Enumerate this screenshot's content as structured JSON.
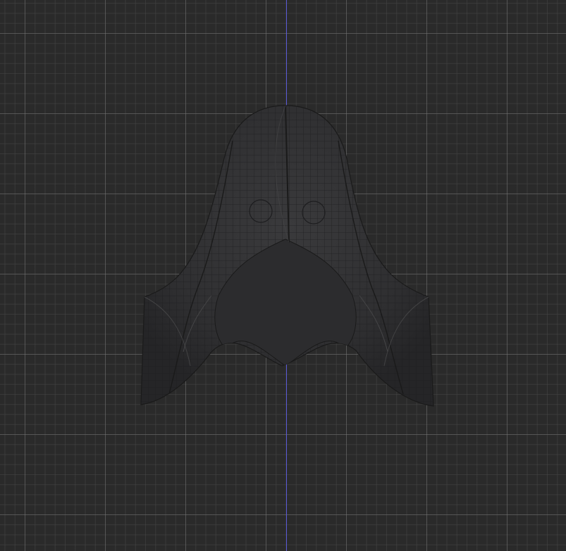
{
  "viewport": {
    "background_color": "#2a2a2a",
    "grid_major_color": "#7a7a7a",
    "grid_minor_color": "#464646",
    "axis_color": "#5a5ad6",
    "axis": "z-axis"
  },
  "model": {
    "shading": "wireframe-on-solid",
    "fill_color": "#333335",
    "wire_color": "#1a1a1a",
    "highlight_color": "#4a4a4c"
  }
}
